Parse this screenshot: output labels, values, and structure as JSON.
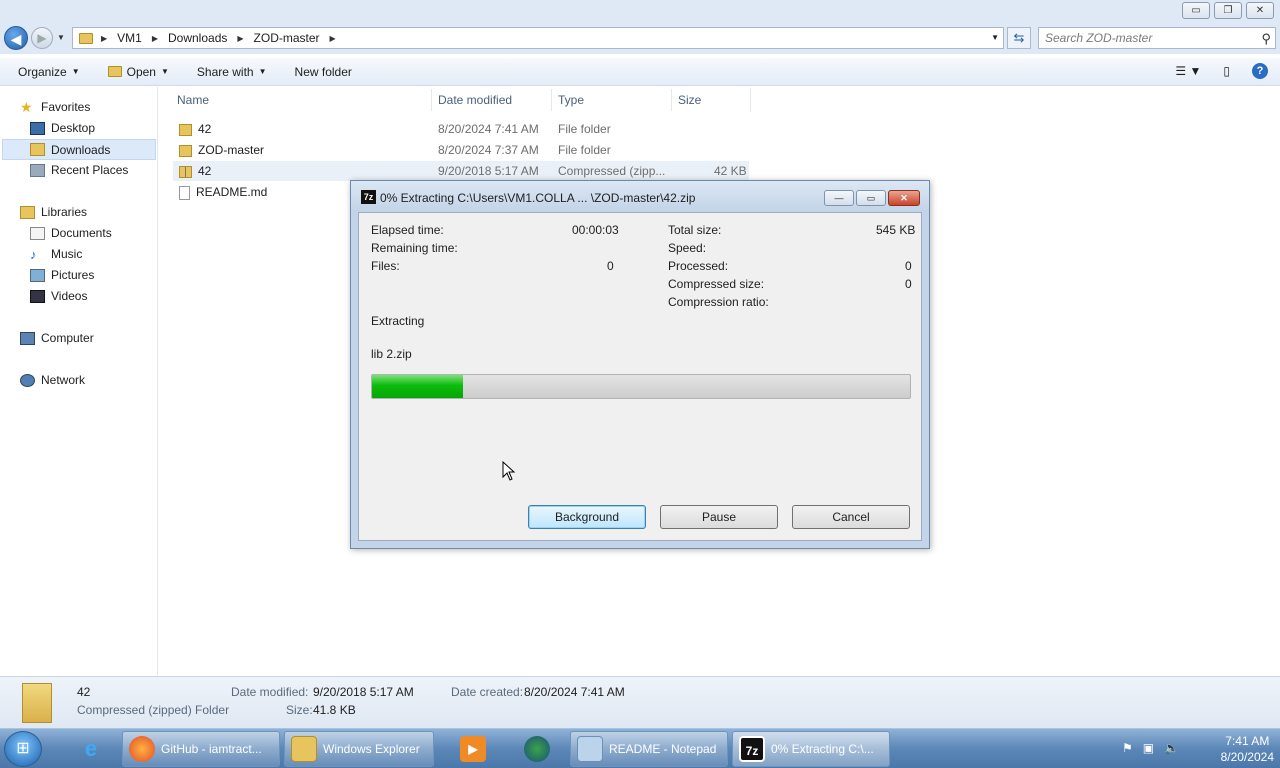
{
  "window": {
    "min_glyph": "▭",
    "max_glyph": "❐",
    "close_glyph": "✕"
  },
  "address": {
    "crumbs": [
      "VM1",
      "Downloads",
      "ZOD-master"
    ],
    "search_placeholder": "Search ZOD-master"
  },
  "toolbar": {
    "organize": "Organize",
    "open": "Open",
    "share_with": "Share with",
    "new_folder": "New folder"
  },
  "nav": {
    "favorites": "Favorites",
    "desktop": "Desktop",
    "downloads": "Downloads",
    "recent_places": "Recent Places",
    "libraries": "Libraries",
    "documents": "Documents",
    "music": "Music",
    "pictures": "Pictures",
    "videos": "Videos",
    "computer": "Computer",
    "network": "Network"
  },
  "columns": {
    "name": "Name",
    "date_modified": "Date modified",
    "type": "Type",
    "size": "Size"
  },
  "files": [
    {
      "name": "42",
      "date": "8/20/2024 7:41 AM",
      "type": "File folder",
      "size": ""
    },
    {
      "name": "ZOD-master",
      "date": "8/20/2024 7:37 AM",
      "type": "File folder",
      "size": ""
    },
    {
      "name": "42",
      "date": "9/20/2018 5:17 AM",
      "type": "Compressed (zipp...",
      "size": "42 KB"
    },
    {
      "name": "README.md",
      "date": "",
      "type": "",
      "size": ""
    }
  ],
  "dialog": {
    "title": "0% Extracting C:\\Users\\VM1.COLLA ... \\ZOD-master\\42.zip",
    "elapsed_label": "Elapsed time:",
    "elapsed_value": "00:00:03",
    "remaining_label": "Remaining time:",
    "files_label": "Files:",
    "files_value": "0",
    "total_size_label": "Total size:",
    "total_size_value": "545 KB",
    "speed_label": "Speed:",
    "processed_label": "Processed:",
    "processed_value": "0",
    "compressed_size_label": "Compressed size:",
    "compressed_size_value": "0",
    "compression_ratio_label": "Compression ratio:",
    "status": "Extracting",
    "current_file": "lib 2.zip",
    "progress_fraction": 0.17,
    "background_button": "Background",
    "pause_button": "Pause",
    "cancel_button": "Cancel"
  },
  "details": {
    "name": "42",
    "kind": "Compressed (zipped) Folder",
    "date_modified_label": "Date modified:",
    "date_modified_value": "9/20/2018 5:17 AM",
    "date_created_label": "Date created:",
    "date_created_value": "8/20/2024 7:41 AM",
    "size_label": "Size:",
    "size_value": "41.8 KB"
  },
  "taskbar": {
    "items": [
      {
        "label": "GitHub - iamtract..."
      },
      {
        "label": "Windows Explorer"
      },
      {
        "label": ""
      },
      {
        "label": ""
      },
      {
        "label": "README - Notepad"
      },
      {
        "label": "0% Extracting C:\\..."
      }
    ],
    "time": "7:41 AM",
    "date": "8/20/2024"
  },
  "colors": {
    "progress_green": "#0cbc0c",
    "taskbar_blue": "#5c87b8",
    "accent_blue": "#1f5fae"
  }
}
